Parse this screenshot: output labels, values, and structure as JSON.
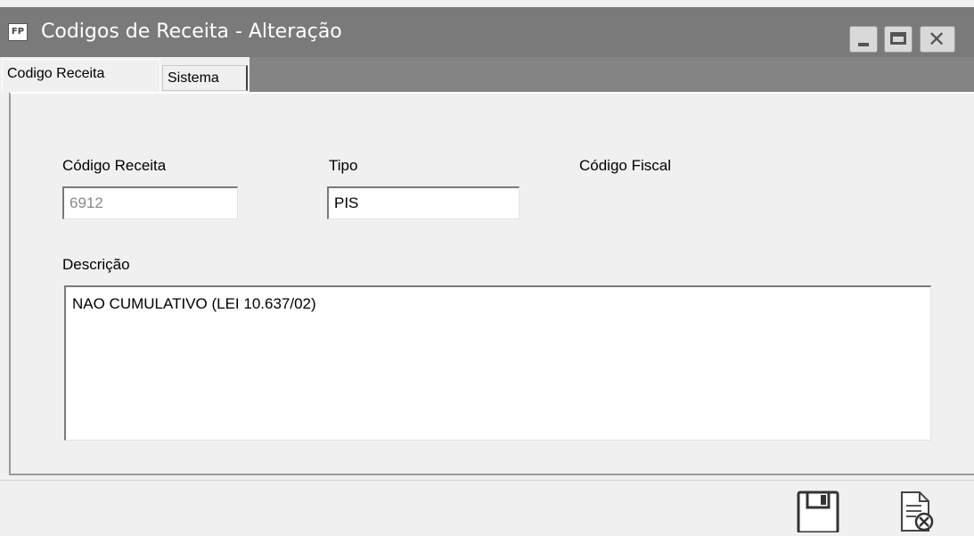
{
  "window": {
    "icon_text": "FP",
    "title": "Codigos de Receita - Alteração"
  },
  "tabs": [
    {
      "label": "Codigo Receita",
      "active": true
    },
    {
      "label": "Sistema",
      "active": false
    }
  ],
  "form": {
    "codigo_receita": {
      "label": "Código Receita",
      "value": "6912"
    },
    "tipo": {
      "label": "Tipo",
      "value": "PIS"
    },
    "codigo_fiscal": {
      "label": "Código Fiscal"
    },
    "descricao": {
      "label": "Descrição",
      "value": "NAO CUMULATIVO (LEI 10.637/02)"
    }
  },
  "toolbar": {
    "save_icon": "floppy-disk-icon",
    "cancel_icon": "document-cancel-icon"
  },
  "colors": {
    "titlebar": "#7a7a7a",
    "background": "#f0f0f0",
    "tab_strip_gray": "#848484"
  }
}
